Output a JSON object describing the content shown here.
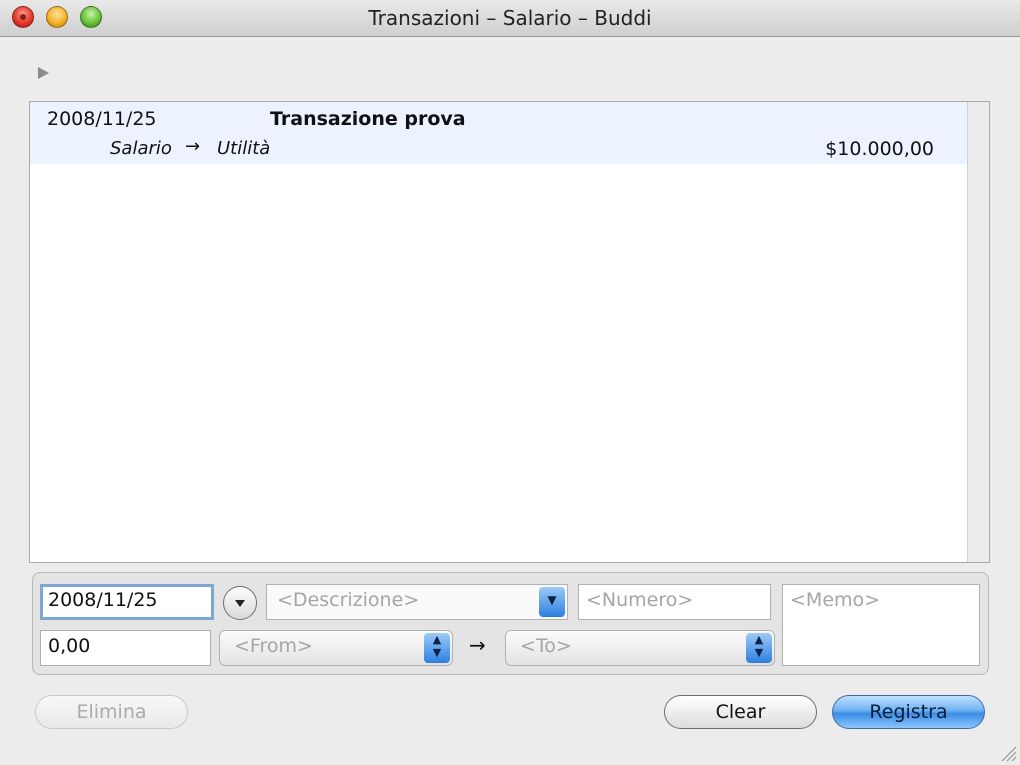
{
  "window": {
    "title": "Transazioni – Salario – Buddi"
  },
  "transactions": [
    {
      "date": "2008/11/25",
      "description": "Transazione prova",
      "from": "Salario",
      "arrow": "→",
      "to": "Utilità",
      "amount": "$10.000,00"
    }
  ],
  "form": {
    "date_value": "2008/11/25",
    "description_placeholder": "<Descrizione>",
    "number_placeholder": "<Numero>",
    "memo_placeholder": "<Memo>",
    "amount_value": "0,00",
    "from_placeholder": "<From>",
    "arrow": "→",
    "to_placeholder": "<To>"
  },
  "buttons": {
    "delete_label": "Elimina",
    "clear_label": "Clear",
    "record_label": "Registra"
  },
  "colors": {
    "row_highlight": "#edf3fe",
    "accent_blue": "#3b8de6",
    "focus_ring": "#7ea7d8"
  }
}
